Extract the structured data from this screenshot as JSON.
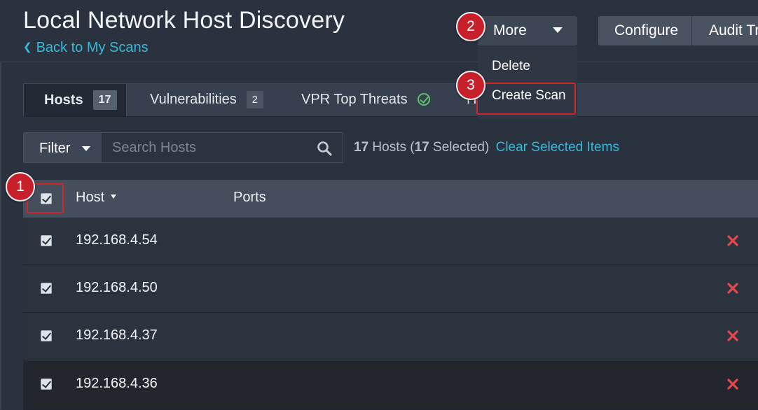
{
  "header": {
    "title": "Local Network Host Discovery",
    "back_link": "Back to My Scans"
  },
  "toolbar": {
    "more_label": "More",
    "configure_label": "Configure",
    "audit_label": "Audit Tr"
  },
  "more_menu": {
    "items": [
      {
        "label": "Delete"
      },
      {
        "label": "Create Scan"
      }
    ]
  },
  "tabs": [
    {
      "label": "Hosts",
      "badge": "17",
      "active": true
    },
    {
      "label": "Vulnerabilities",
      "badge": "2"
    },
    {
      "label": "VPR Top Threats"
    },
    {
      "label": "H"
    }
  ],
  "filter": {
    "button_label": "Filter",
    "search_placeholder": "Search Hosts"
  },
  "summary": {
    "hosts_count": "17",
    "hosts_text": "Hosts (",
    "selected_count": "17",
    "selected_text": "Selected)",
    "clear_link": "Clear Selected Items"
  },
  "table": {
    "columns": [
      "Host",
      "Ports"
    ],
    "rows": [
      {
        "host": "192.168.4.54",
        "selected": true
      },
      {
        "host": "192.168.4.50",
        "selected": true
      },
      {
        "host": "192.168.4.37",
        "selected": true
      },
      {
        "host": "192.168.4.36",
        "selected": true
      }
    ]
  },
  "callouts": [
    "1",
    "2",
    "3"
  ],
  "colors": {
    "accent_link": "#39b8d6",
    "callout_red": "#c8202a",
    "delete_red": "#e5484d",
    "check_green": "#5fbf6a"
  },
  "icons": [
    "chevron-left-icon",
    "caret-down-icon",
    "check-circle-icon",
    "search-icon",
    "checkbox-checked-icon",
    "delete-x-icon",
    "sort-caret-icon"
  ]
}
